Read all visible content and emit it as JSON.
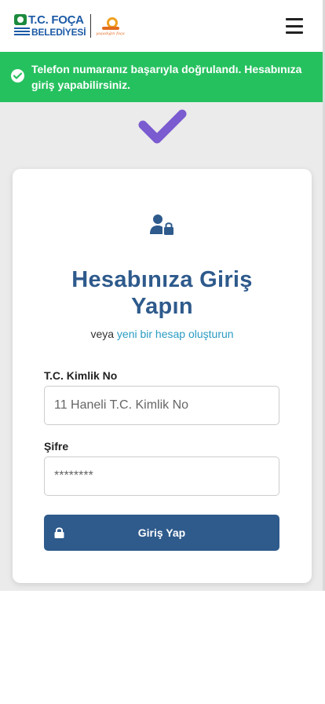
{
  "header": {
    "logo": {
      "title": "T.C. FOÇA",
      "subtitle": "BELEDİYESİ",
      "tagline": "yaşadığın foça"
    },
    "menu_icon": "hamburger-menu-icon"
  },
  "alert": {
    "icon": "check-circle-icon",
    "message": "Telefon numaranız başarıyla doğrulandı. Hesabınıza giriş yapabilirsiniz.",
    "color": "#26c15f"
  },
  "success_icon": {
    "name": "checkmark-icon",
    "color": "#7b5bd0"
  },
  "card": {
    "icon": "user-lock-icon",
    "title_line1": "Hesabınıza Giriş",
    "title_line2": "Yapın",
    "subtitle_prefix": "veya",
    "subtitle_link": "yeni bir hesap oluşturun",
    "tc_field": {
      "label": "T.C. Kimlik No",
      "placeholder": "11 Haneli T.C. Kimlik No",
      "value": ""
    },
    "password_field": {
      "label": "Şifre",
      "placeholder": "********",
      "value": ""
    },
    "login_button": {
      "label": "Giriş Yap",
      "icon": "lock-icon"
    }
  },
  "colors": {
    "primary": "#2e5a8c",
    "link": "#2a9bc2",
    "background": "#ebebeb"
  }
}
